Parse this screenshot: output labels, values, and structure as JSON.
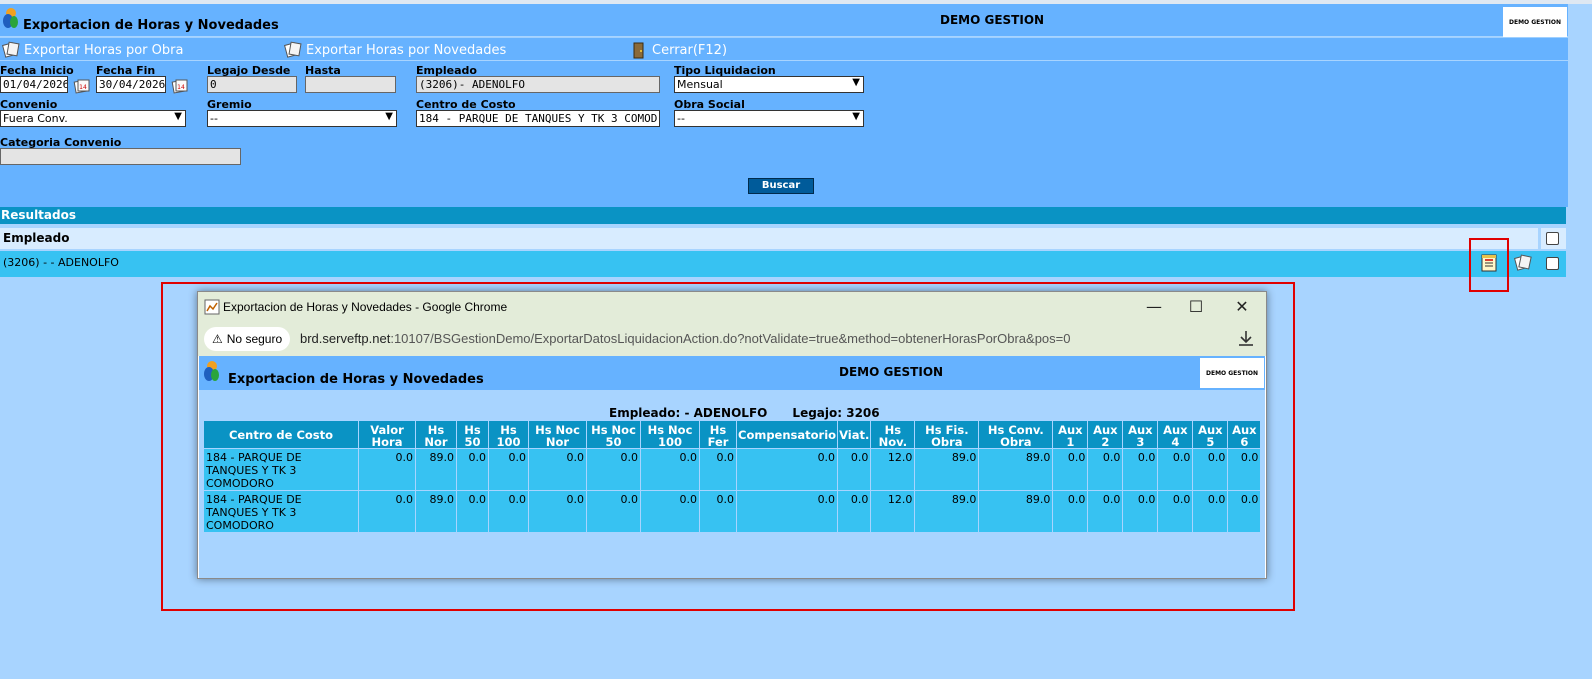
{
  "app": {
    "title": "Exportacion de Horas y Novedades",
    "company": "DEMO GESTION",
    "brand_text": "DEMO GESTION"
  },
  "toolbar": {
    "export_obra": "Exportar Horas por Obra",
    "export_novedades": "Exportar Horas por Novedades",
    "close": "Cerrar(F12)"
  },
  "filters": {
    "fecha_inicio": {
      "label": "Fecha Inicio",
      "value": "01/04/2026"
    },
    "fecha_fin": {
      "label": "Fecha Fin",
      "value": "30/04/2026"
    },
    "legajo_desde": {
      "label": "Legajo Desde",
      "value": "0"
    },
    "hasta": {
      "label": "Hasta",
      "value": ""
    },
    "empleado": {
      "label": "Empleado",
      "value": "(3206)- ADENOLFO"
    },
    "tipo_liquidacion": {
      "label": "Tipo Liquidacion",
      "value": "Mensual"
    },
    "convenio": {
      "label": "Convenio",
      "value": "Fuera Conv."
    },
    "gremio": {
      "label": "Gremio",
      "value": "--"
    },
    "centro_costo": {
      "label": "Centro de Costo",
      "value": "184 - PARQUE DE TANQUES Y TK 3 COMOD"
    },
    "obra_social": {
      "label": "Obra Social",
      "value": "--"
    },
    "categoria_convenio": {
      "label": "Categoria Convenio",
      "value": ""
    },
    "buscar": "Buscar"
  },
  "results": {
    "title": "Resultados",
    "column_header": "Empleado",
    "rows": [
      {
        "label": "(3206) - - ADENOLFO"
      }
    ]
  },
  "popup": {
    "window_title": "Exportacion de Horas y Novedades - Google Chrome",
    "security_label": "No seguro",
    "url_host": "brd.serveftp.net",
    "url_rest": ":10107/BSGestionDemo/ExportarDatosLiquidacionAction.do?notValidate=true&method=obtenerHorasPorObra&pos=0",
    "title": "Exportacion de Horas y Novedades",
    "company": "DEMO GESTION",
    "brand_text": "DEMO GESTION",
    "employee_label": "Empleado: - ADENOLFO",
    "legajo_label": "Legajo: 3206",
    "table": {
      "headers": [
        "Centro de Costo",
        "Valor Hora",
        "Hs Nor",
        "Hs 50",
        "Hs 100",
        "Hs Noc Nor",
        "Hs Noc 50",
        "Hs Noc 100",
        "Hs Fer",
        "Compensatorio",
        "Viat.",
        "Hs Nov.",
        "Hs Fis. Obra",
        "Hs Conv. Obra",
        "Aux 1",
        "Aux 2",
        "Aux 3",
        "Aux 4",
        "Aux 5",
        "Aux 6"
      ],
      "rows": [
        [
          "184 - PARQUE DE TANQUES Y TK 3 COMODORO",
          "0.0",
          "89.0",
          "0.0",
          "0.0",
          "0.0",
          "0.0",
          "0.0",
          "0.0",
          "0.0",
          "0.0",
          "12.0",
          "89.0",
          "89.0",
          "0.0",
          "0.0",
          "0.0",
          "0.0",
          "0.0",
          "0.0"
        ],
        [
          "184 - PARQUE DE TANQUES Y TK 3 COMODORO",
          "0.0",
          "89.0",
          "0.0",
          "0.0",
          "0.0",
          "0.0",
          "0.0",
          "0.0",
          "0.0",
          "0.0",
          "12.0",
          "89.0",
          "89.0",
          "0.0",
          "0.0",
          "0.0",
          "0.0",
          "0.0",
          "0.0"
        ]
      ]
    }
  },
  "colors": {
    "header_blue": "#66b2ff",
    "page_blue": "#a8d4ff",
    "results_bar": "#0a93c4",
    "row_cyan": "#37c2f2",
    "highlight_red": "#e00000"
  }
}
